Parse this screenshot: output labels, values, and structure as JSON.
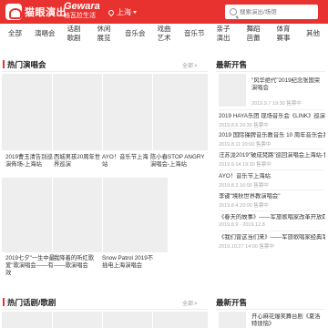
{
  "header": {
    "brand": "猫眼演出",
    "gewara_en": "Gewara",
    "gewara_cn": "格瓦拉生活",
    "city": "上海",
    "search_placeholder": "搜索演出/场馆"
  },
  "nav": {
    "items": [
      "全部",
      "演唱会",
      "话剧歌剧",
      "休闲展览",
      "音乐会",
      "戏曲艺术",
      "音乐节",
      "亲子演出",
      "舞蹈芭蕾",
      "体育赛事",
      "其他"
    ]
  },
  "concerts": {
    "title": "热门演唱会",
    "more": "全部",
    "items": [
      "2019曹玉清告别巡演佈场-上海站",
      "西城男孩20周年世界巡演",
      "AYO！音乐节上海站",
      "陈小春STOP ANGRY演唱会-上海站",
      "2019七夕\"一生中最爱\"歌演唱会——有效",
      "我降着的听红歌——歌演唱会",
      "Snow Patrol 2019不插电上海演唱会"
    ]
  },
  "news": {
    "title": "最新开售",
    "items": [
      {
        "title": "\"风华绝代\"2019纪念张国荣演唱会",
        "date": "2019.9.7 19:30 售票中"
      },
      {
        "title": "2019 HAYA乐团 现场音乐会《LINK》巡演 上海站",
        "date": "2019.8.6 20:30 售票中"
      },
      {
        "title": "2019 国际操牌音乐教音乐 10 周年音乐会系列演出",
        "date": "2019.8.11 20:00 售票中"
      },
      {
        "title": "汪苏泷2019\"破成梵路\"巡回演唱会上海站-售票中",
        "date": "2019.9.14 19:30 售票中"
      },
      {
        "title": "AYO！音乐节上海站",
        "date": "2019.8.3 16:00 售票中"
      },
      {
        "title": "李键\"境秋世界教演唱会\"",
        "date": "2019.8.4 20:00 售票中"
      },
      {
        "title": "《春天的故事》——军旅歌唱家改革开放四十周年",
        "date": "2019.8.9 - 2019.12.8"
      },
      {
        "title": "《我们曾这当们来》——军旅歌唱家经典军歌上海专场演唱会",
        "date": "2019.10.27 14:00 售票中"
      }
    ]
  },
  "drama": {
    "title": "热门话剧/歌剧",
    "more": "全部"
  },
  "news2": {
    "title": "最新开售",
    "items": [
      {
        "title": "开心麻花爆笑舞台剧《夏洛特烦恼》"
      }
    ]
  }
}
